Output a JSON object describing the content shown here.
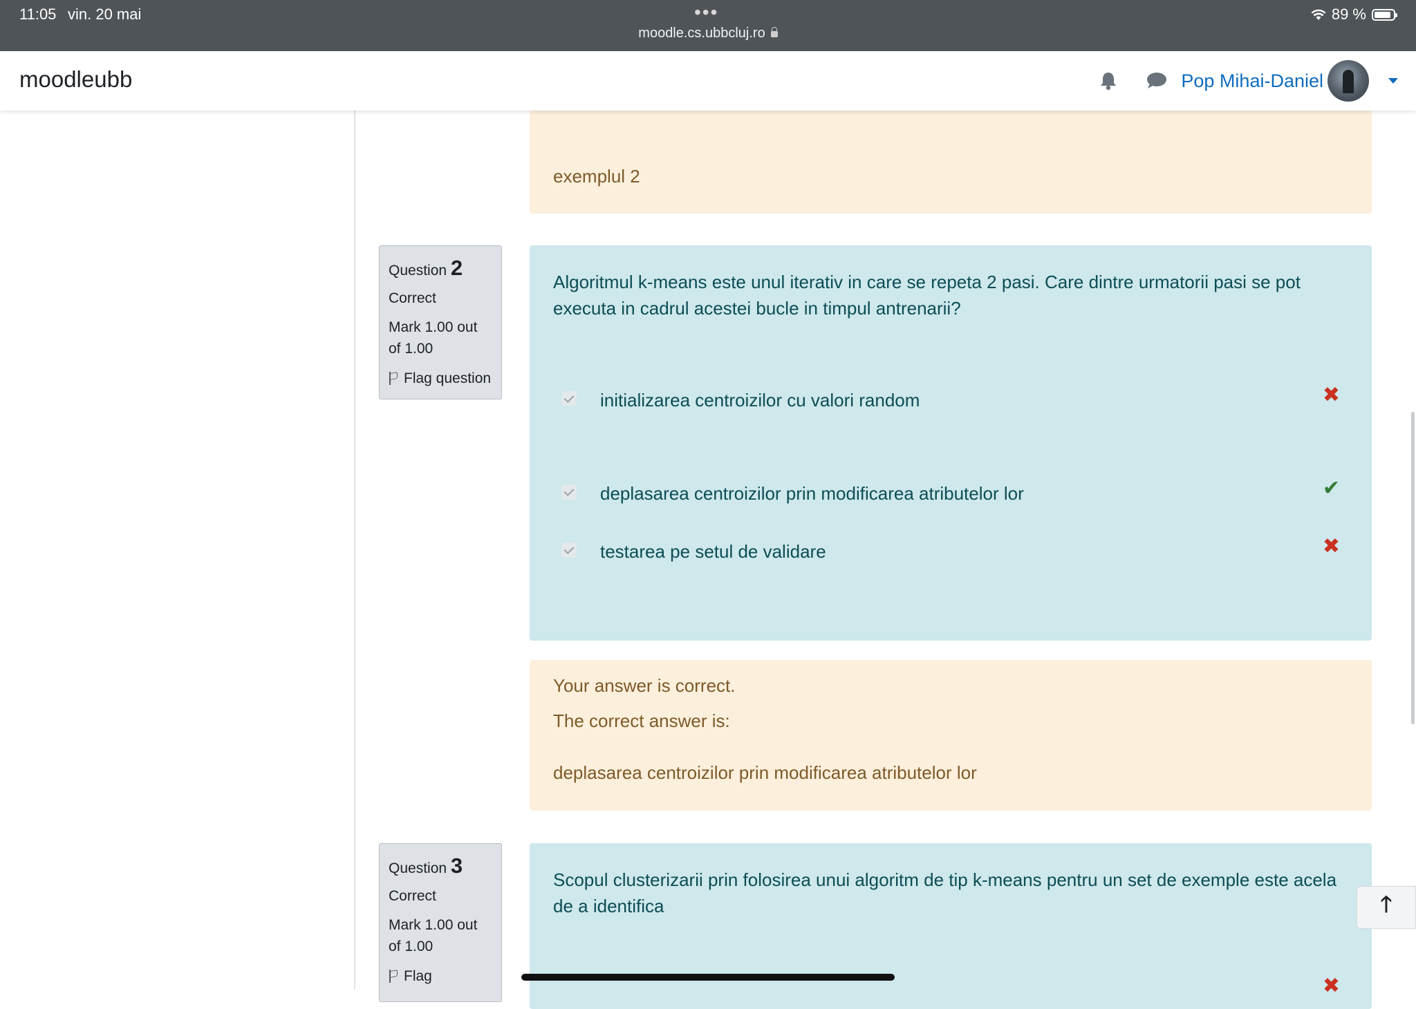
{
  "status_bar": {
    "time": "11:05",
    "date": "vin. 20 mai",
    "url": "moodle.cs.ubbcluj.ro",
    "battery": "89 %",
    "battery_level": 0.89,
    "dots": "•••"
  },
  "navbar": {
    "brand": "moodleubb",
    "user_name": "Pop Mihai-Daniel"
  },
  "prev_feedback": {
    "text": "exemplul 2"
  },
  "question2": {
    "label": "Question",
    "number": "2",
    "state": "Correct",
    "grade": "Mark 1.00 out of 1.00",
    "flag": "Flag question",
    "text": "Algoritmul k-means este unul iterativ in care se repeta 2 pasi. Care dintre urmatorii pasi se pot executa in cadrul acestei bucle in timpul antrenarii?",
    "answers": [
      {
        "text": "initializarea centroizilor cu valori random",
        "mark": "✖"
      },
      {
        "text": "deplasarea centroizilor prin modificarea atributelor lor",
        "mark": "✔"
      },
      {
        "text": "testarea pe setul de validare",
        "mark": "✖"
      }
    ],
    "feedback": {
      "state_text": "Your answer is correct.",
      "right_answer_label": "The correct answer is:",
      "right_answer": "deplasarea centroizilor prin modificarea atributelor lor"
    }
  },
  "question3": {
    "label": "Question",
    "number": "3",
    "state": "Correct",
    "grade": "Mark 1.00 out of 1.00",
    "flag": "Flag",
    "text": "Scopul clusterizarii prin folosirea unui algoritm de tip k-means pentru un set de exemple este acela de a identifica",
    "first_mark": "✖"
  },
  "back_to_top": "🡑",
  "colors": {
    "link_blue": "#0f6cbf",
    "formulation_bg": "#cee8ec",
    "feedback_bg": "#fcefdc",
    "incorrect": "#ca3120",
    "correct": "#357a32"
  }
}
